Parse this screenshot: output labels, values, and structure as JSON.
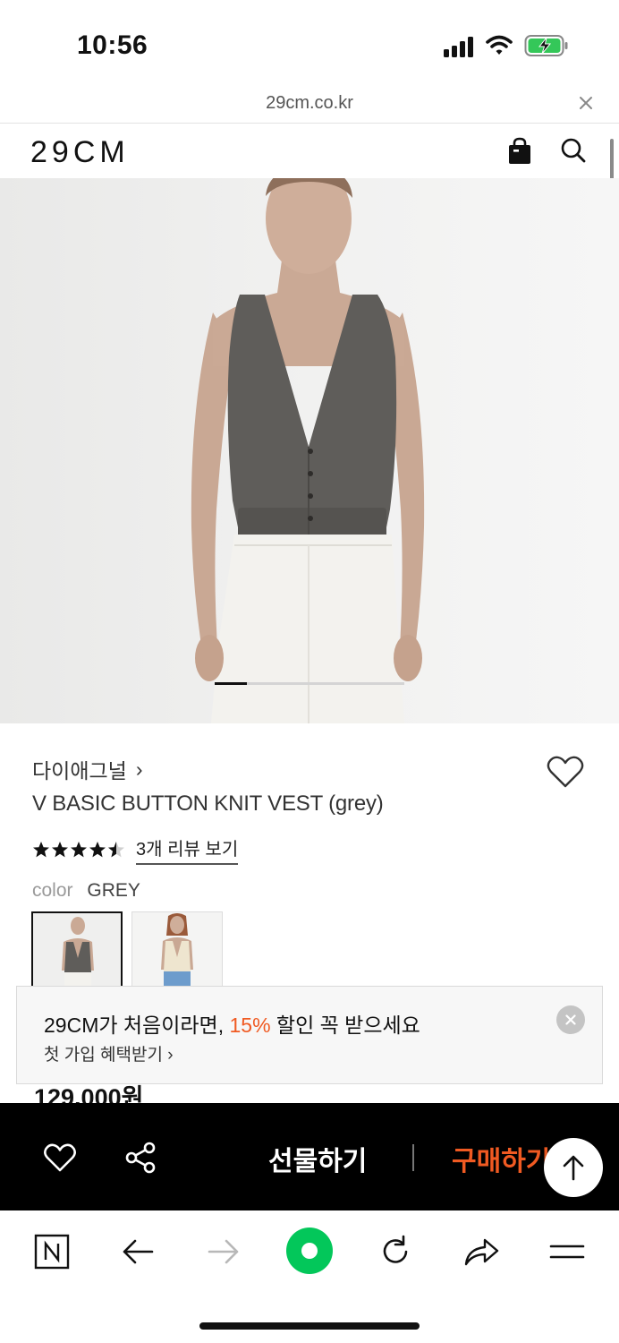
{
  "status_bar": {
    "time": "10:56",
    "icons": [
      "signal-icon",
      "wifi-icon",
      "battery-charging-icon"
    ]
  },
  "browser": {
    "url": "29cm.co.kr"
  },
  "header": {
    "logo": "29CM",
    "icons": [
      "shopping-bag-icon",
      "search-icon"
    ]
  },
  "product": {
    "brand": "다이애그널",
    "brand_chevron": "›",
    "title": "V BASIC BUTTON KNIT VEST  (grey)",
    "rating": 4.5,
    "review_link": "3개 리뷰 보기",
    "color_label": "color",
    "color_value": "GREY",
    "swatches": [
      "grey",
      "ivory"
    ],
    "price": "129,000원",
    "image_index": 1,
    "image_count": 6
  },
  "promo": {
    "line1_prefix": "29CM가 처음이라면, ",
    "line1_highlight": "15%",
    "line1_suffix": " 할인 꼭 받으세요",
    "line2": "첫 가입 혜택받기 ›"
  },
  "action_bar": {
    "gift_label": "선물하기",
    "buy_label": "구매하기"
  },
  "colors": {
    "accent": "#f05a22",
    "action_bar_bg": "#000000",
    "home_button": "#03c75a"
  }
}
